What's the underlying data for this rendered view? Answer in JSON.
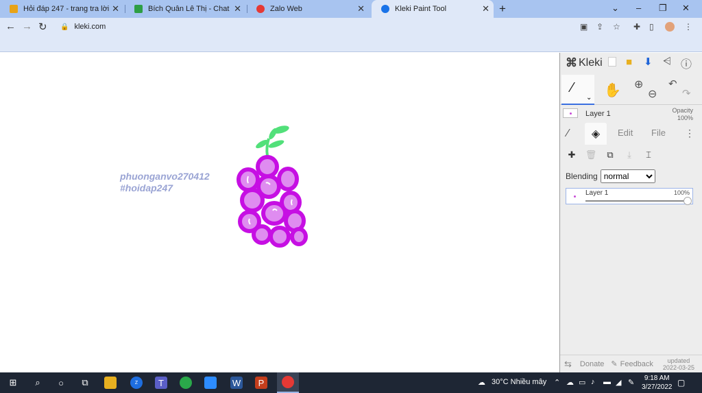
{
  "tabs": [
    {
      "title": "Hỏi đáp 247 - trang tra lời",
      "favicon_color": "#e8a317"
    },
    {
      "title": "Bích Quân Lê Thị - Chat",
      "favicon_color": "#2e9e44"
    },
    {
      "title": "Zalo Web",
      "favicon_color": "#e53935"
    },
    {
      "title": "Kleki Paint Tool",
      "favicon_color": "#1a73e8",
      "active": true
    }
  ],
  "tab_close": "✕",
  "newtab": "+",
  "window_controls": [
    "⌄",
    "–",
    "❐",
    "✕"
  ],
  "toolbar": {
    "back": "←",
    "forward": "→",
    "reload": "↻",
    "url": "kleki.com"
  },
  "canvas": {
    "watermark_line1": "phuonganvo270412",
    "watermark_line2": "#hoidap247",
    "drawing_colors": {
      "grape_outline": "#c60fe3",
      "grape_fill": "#df8cf0",
      "leaf": "#52e07a"
    }
  },
  "kleki": {
    "logo": "Kleki",
    "layer_name_top": "Layer 1",
    "opacity_label": "Opacity",
    "opacity_value": "100%",
    "tab_edit": "Edit",
    "tab_file": "File",
    "blending_label": "Blending",
    "blending_value": "normal",
    "layer_item_name": "Layer 1",
    "layer_item_opacity": "100%",
    "layer_item_opacity_level": 1.0,
    "footer_donate": "Donate",
    "footer_feedback": "Feedback",
    "footer_updated_label": "updated",
    "footer_updated_date": "2022-03-25"
  },
  "taskbar": {
    "weather": "30°C Nhiều mây",
    "time": "9:18 AM",
    "date": "3/27/2022"
  }
}
